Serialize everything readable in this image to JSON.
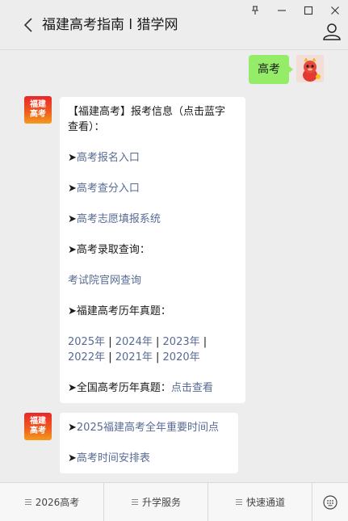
{
  "header": {
    "title": "福建高考指南 l 猎学网"
  },
  "user_message": {
    "text": "高考"
  },
  "bot": {
    "avatar_line1": "福建",
    "avatar_line2": "高考"
  },
  "message1": {
    "intro_line1": "【福建高考】报考信息（点击蓝字",
    "intro_line2": "查看）：",
    "arrow": "➤",
    "link_signup": "高考报名入口",
    "link_score": "高考查分入口",
    "link_volunteer": "高考志愿填报系统",
    "admission_label": "➤高考录取查询：",
    "admission_link": "考试院官网查询",
    "past_label": "➤福建高考历年真题：",
    "years": [
      "2025年",
      "2024年",
      "2023年",
      "2022年",
      "2021年",
      "2020年"
    ],
    "separator": "|",
    "national_label": "➤全国高考历年真题：",
    "national_link": "点击查看"
  },
  "message2": {
    "arrow": "➤",
    "link_timeline": "2025福建高考全年重要时间点",
    "link_schedule": "高考时间安排表"
  },
  "bottom_menu": {
    "items": [
      "2026高考",
      "升学服务",
      "快速通道"
    ]
  }
}
